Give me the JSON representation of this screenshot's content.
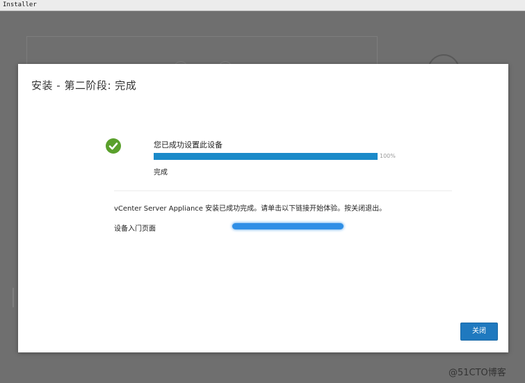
{
  "window": {
    "title": "Installer"
  },
  "dialog": {
    "title": "安装 - 第二阶段: 完成",
    "status": "您已成功设置此设备",
    "progress": {
      "percent": 100,
      "label": "100%"
    },
    "done": "完成",
    "message": "vCenter Server Appliance 安装已成功完成。请单击以下链接开始体验。按关闭退出。",
    "link_label": "设备入门页面",
    "close_label": "关闭"
  },
  "colors": {
    "accent": "#1b8ac9",
    "success": "#5aa02c",
    "button": "#1f79bf"
  },
  "watermark": "@51CTO博客"
}
